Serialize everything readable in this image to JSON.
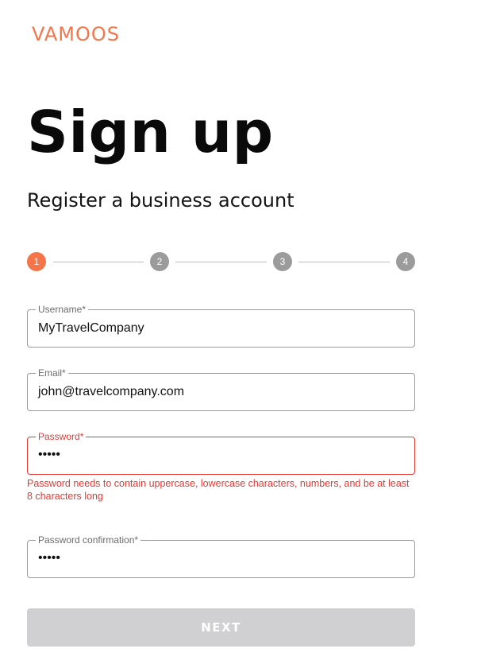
{
  "brand": {
    "logo_text": "VAMOOS",
    "accent_color": "#f4754a"
  },
  "header": {
    "title": "Sign up",
    "subtitle": "Register a business account"
  },
  "stepper": {
    "current_step": 1,
    "steps": [
      "1",
      "2",
      "3",
      "4"
    ]
  },
  "form": {
    "username": {
      "label": "Username*",
      "value": "MyTravelCompany"
    },
    "email": {
      "label": "Email*",
      "value": "john@travelcompany.com"
    },
    "password": {
      "label": "Password*",
      "value": "•••••",
      "error": "Password needs to contain uppercase, lowercase characters, numbers, and be at least 8 characters long",
      "error_color": "#e53935"
    },
    "password_confirmation": {
      "label": "Password confirmation*",
      "value": "•••••"
    }
  },
  "actions": {
    "next_label": "NEXT",
    "next_disabled": true
  }
}
